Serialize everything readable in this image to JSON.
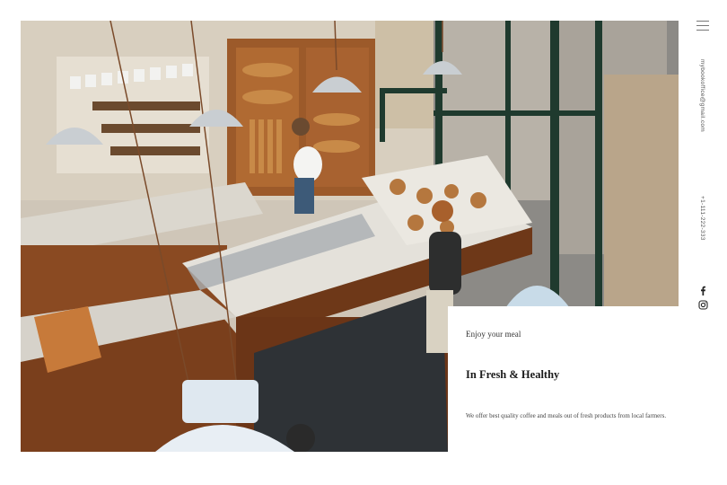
{
  "nav": {
    "menu_icon": "hamburger-menu-icon"
  },
  "contact": {
    "email": "mybookoffice@gmail.com",
    "phone": "+1-111-222-333"
  },
  "social": {
    "facebook_icon": "facebook-icon",
    "instagram_icon": "instagram-icon"
  },
  "feature": {
    "eyebrow": "Enjoy your meal",
    "title": "In Fresh & Healthy",
    "body": "We offer best quality coffee and meals out of fresh products from local farmers."
  },
  "colors": {
    "wood": "#7a3f1c",
    "marble": "#d9d6cf",
    "floor": "#2e3236",
    "window_frame": "#1f3a2e",
    "text_dark": "#1a1a1a"
  }
}
